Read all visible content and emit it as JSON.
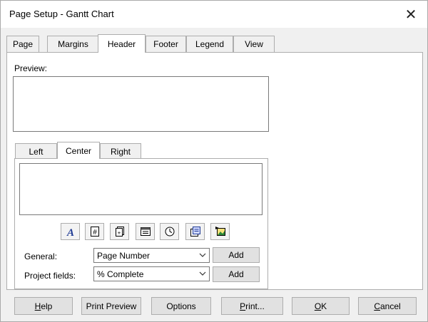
{
  "window": {
    "title": "Page Setup - Gantt Chart",
    "close_glyph": "✕"
  },
  "tabs": [
    {
      "label": "Page",
      "active": false
    },
    {
      "label": "Margins",
      "active": false
    },
    {
      "label": "Header",
      "active": true
    },
    {
      "label": "Footer",
      "active": false
    },
    {
      "label": "Legend",
      "active": false
    },
    {
      "label": "View",
      "active": false
    }
  ],
  "preview": {
    "label": "Preview:"
  },
  "alignment_tabs": [
    {
      "label": "Left",
      "active": false
    },
    {
      "label": "Center",
      "active": true
    },
    {
      "label": "Right",
      "active": false
    }
  ],
  "toolbar_icons": [
    "format-text-font-icon",
    "insert-page-number-icon",
    "insert-total-pages-icon",
    "insert-current-date-icon",
    "insert-current-time-icon",
    "insert-file-name-icon",
    "insert-picture-icon"
  ],
  "general": {
    "label": "General:",
    "selected": "Page Number",
    "add_label": "Add"
  },
  "project_fields": {
    "label": "Project fields:",
    "selected": "% Complete",
    "add_label": "Add"
  },
  "buttons": {
    "help_mnemonic": "H",
    "help_rest": "elp",
    "print_preview": "Print Preview",
    "options": "Options",
    "print_mnemonic": "P",
    "print_rest": "rint...",
    "ok_mnemonic": "O",
    "ok_rest": "K",
    "cancel_mnemonic": "C",
    "cancel_rest": "ancel"
  },
  "colors": {
    "dialog_bg": "#f0f0f0",
    "button_face": "#e1e1e1",
    "border": "#adadad",
    "icon_blue": "#1f3a93"
  }
}
